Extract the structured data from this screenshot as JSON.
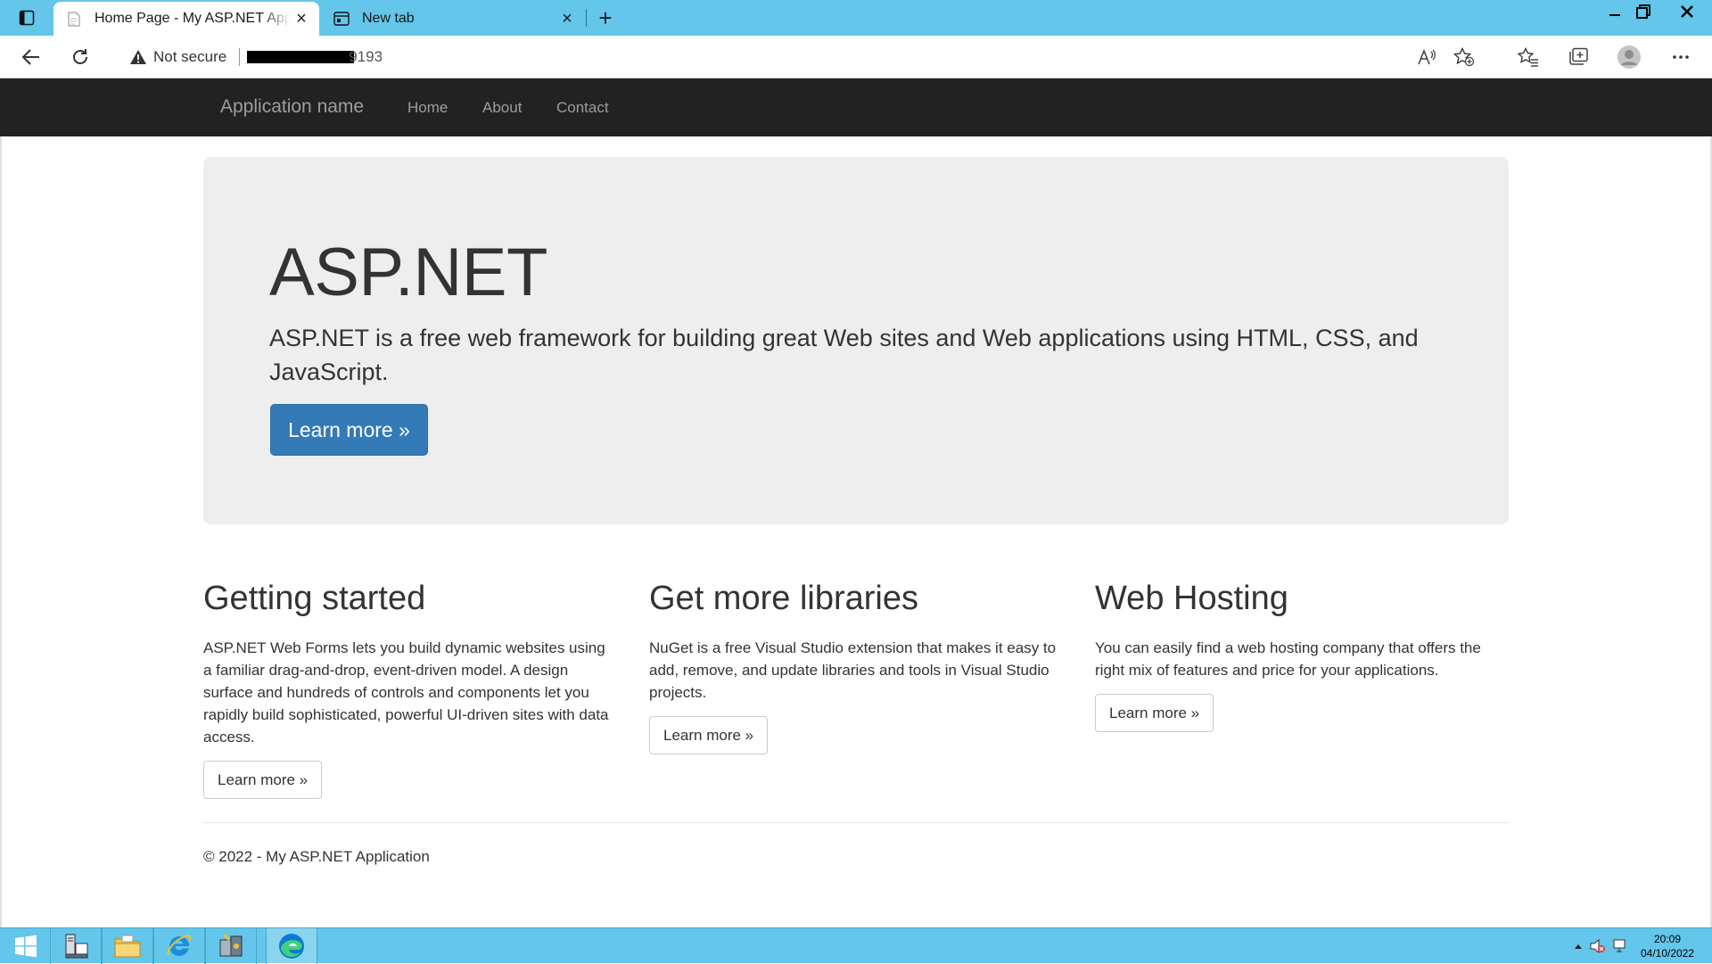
{
  "browser": {
    "tabs": [
      {
        "title": "Home Page - My ASP.NET Applic",
        "active": true,
        "close": "×"
      },
      {
        "title": "New tab",
        "active": false,
        "close": "×"
      }
    ],
    "new_tab": "+",
    "security_label": "Not secure",
    "url_visible": "9193",
    "icons": [
      "tab-actions-icon",
      "back-arrow-icon",
      "refresh-icon",
      "warning-icon",
      "read-aloud-icon",
      "add-favorite-icon",
      "favorites-icon",
      "collections-icon",
      "profile-icon",
      "more-menu-icon"
    ]
  },
  "navbar": {
    "brand": "Application name",
    "links": [
      "Home",
      "About",
      "Contact"
    ]
  },
  "jumbotron": {
    "title": "ASP.NET",
    "lead": "ASP.NET is a free web framework for building great Web sites and Web applications using HTML, CSS, and JavaScript.",
    "button": "Learn more »"
  },
  "columns": [
    {
      "heading": "Getting started",
      "text": "ASP.NET Web Forms lets you build dynamic websites using a familiar drag-and-drop, event-driven model. A design surface and hundreds of controls and components let you rapidly build sophisticated, powerful UI-driven sites with data access.",
      "button": "Learn more »"
    },
    {
      "heading": "Get more libraries",
      "text": "NuGet is a free Visual Studio extension that makes it easy to add, remove, and update libraries and tools in Visual Studio projects.",
      "button": "Learn more »"
    },
    {
      "heading": "Web Hosting",
      "text": "You can easily find a web hosting company that offers the right mix of features and price for your applications.",
      "button": "Learn more »"
    }
  ],
  "footer": "© 2022 - My ASP.NET Application",
  "taskbar": {
    "time": "20:09",
    "date": "04/10/2022",
    "apps": [
      "start-icon",
      "server-manager-icon",
      "file-explorer-icon",
      "internet-explorer-icon",
      "tools-icon",
      "edge-icon"
    ]
  },
  "colors": {
    "chrome_accent": "#63c6ea",
    "navbar_bg": "#222222",
    "primary_button": "#337ab7",
    "jumbotron_bg": "#eeeeee"
  }
}
